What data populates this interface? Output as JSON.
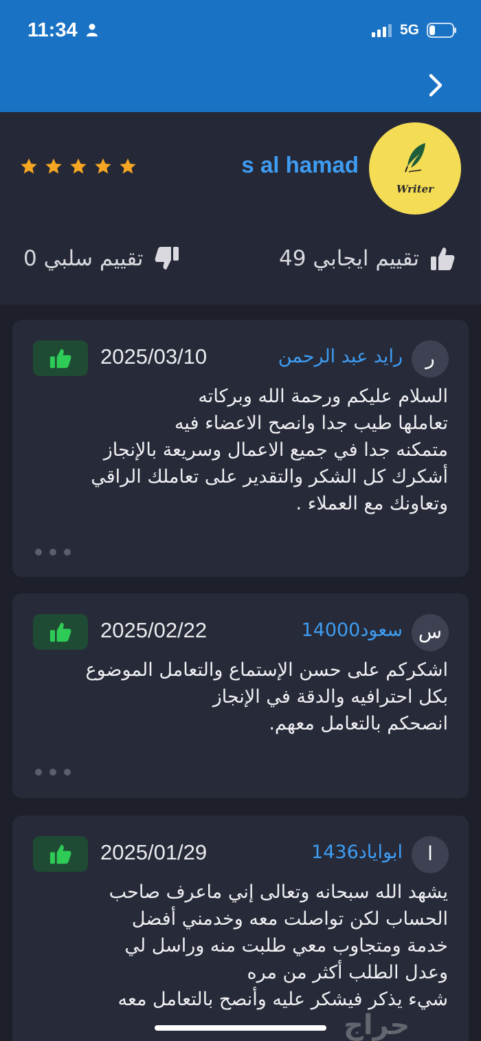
{
  "status_bar": {
    "time": "11:34",
    "network": "5G",
    "icons": [
      "person-icon",
      "signal-icon",
      "battery-icon"
    ]
  },
  "nav": {
    "back_icon": "chevron-right-icon"
  },
  "profile": {
    "avatar_text": "Writer",
    "avatar_icon": "quill-icon",
    "username": "s al hamad",
    "star_rating": 5,
    "star_color": "#f5a623",
    "positive_label": "تقييم ايجابي 49",
    "negative_label": "تقييم سلبي 0"
  },
  "colors": {
    "header_blue": "#1a72c4",
    "accent_blue": "#3e9df3",
    "positive_green": "#2ecc57",
    "background": "#1d1f2a"
  },
  "reviews": [
    {
      "avatar_letter": "ر",
      "name": "رايد عبد الرحمن",
      "date": "2025/03/10",
      "rating_icon": "thumbs-up-icon",
      "lines": [
        "السلام عليكم ورحمة الله وبركاته",
        "تعاملها طيب جدا وانصح الاعضاء فيه",
        "متمكنه جدا في جميع الاعمال وسريعة بالإنجاز",
        "أشكرك كل الشكر والتقدير على تعاملك الراقي",
        "وتعاونك مع العملاء ."
      ],
      "more_icon": "ellipsis-icon"
    },
    {
      "avatar_letter": "س",
      "name": "سعود14000",
      "date": "2025/02/22",
      "rating_icon": "thumbs-up-icon",
      "lines": [
        "اشكركم على حسن الإستماع والتعامل الموضوع",
        "بكل احترافيه والدقة في الإنجاز",
        "انصحكم بالتعامل معهم."
      ],
      "more_icon": "ellipsis-icon"
    },
    {
      "avatar_letter": "ا",
      "name": "ابواياد1436",
      "date": "2025/01/29",
      "rating_icon": "thumbs-up-icon",
      "lines": [
        "يشهد الله سبحانه وتعالى إني ماعرف صاحب",
        "الحساب لكن تواصلت معه وخدمني أفضل",
        "خدمة ومتجاوب معي طلبت منه وراسل لي",
        "وعدل الطلب أكثر من مره",
        "شيء يذكر فيشكر عليه وأنصح بالتعامل معه"
      ]
    }
  ],
  "watermark": "حراج"
}
